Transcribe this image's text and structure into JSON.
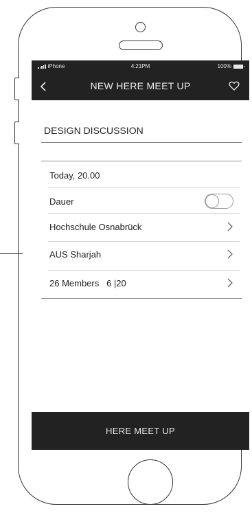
{
  "status_bar": {
    "carrier": "iPhone",
    "time": "4:21PM",
    "battery": "100%"
  },
  "nav": {
    "back_icon": "chevron-left-icon",
    "title": "NEW HERE MEET UP",
    "favorite_icon": "heart-icon"
  },
  "event": {
    "title": "DESIGN DISCUSSION"
  },
  "details": {
    "date": "Today, 20.00",
    "duration_label": "Dauer",
    "duration_toggle_on": false,
    "location_1": "Hochschule Osnabrück",
    "location_2": "AUS Sharjah",
    "members": "26 Members   6 |20"
  },
  "action": {
    "label": "HERE MEET UP"
  },
  "colors": {
    "bar_background": "#222222",
    "bar_text": "#e8e8e8",
    "text": "#222222",
    "divider": "#cfcfcf"
  }
}
